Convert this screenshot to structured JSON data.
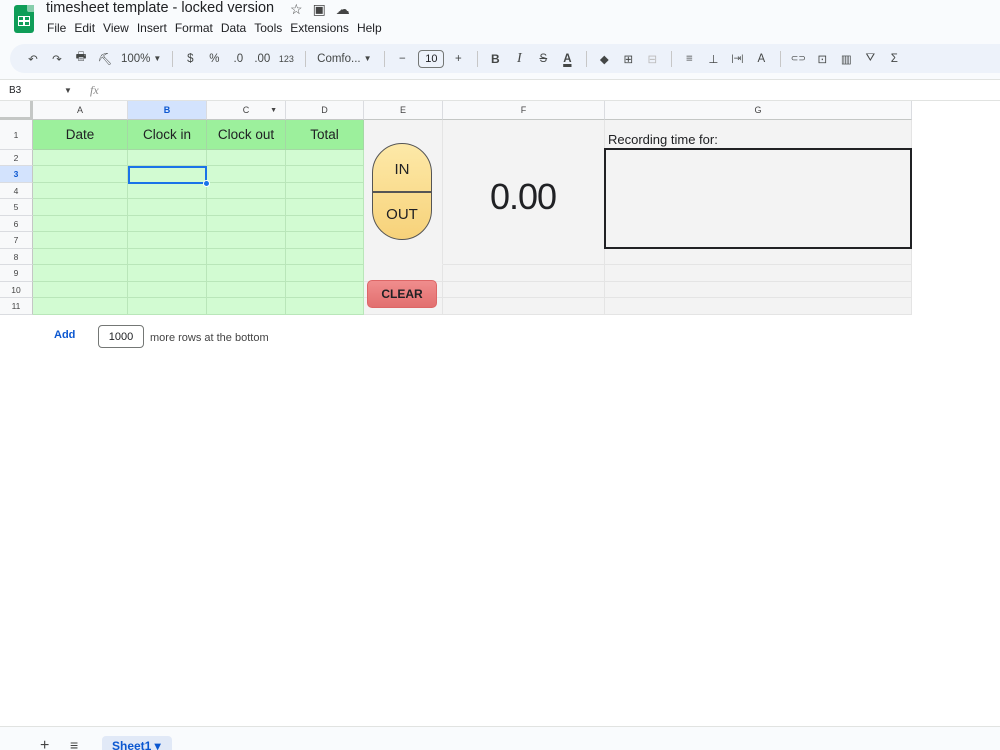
{
  "app": {
    "doc_title": "timesheet template - locked version",
    "menu": [
      "File",
      "Edit",
      "View",
      "Insert",
      "Format",
      "Data",
      "Tools",
      "Extensions",
      "Help"
    ],
    "brand_color": "#0f9d58"
  },
  "toolbar": {
    "undo": "↶",
    "redo": "↷",
    "print": "🖶",
    "paint_format": "⛏",
    "zoom": "100%",
    "currency": "$",
    "percent": "%",
    "decrease_decimal": ".0",
    "increase_decimal": ".00",
    "number_format": "123",
    "font": "Comfo...",
    "font_size_minus": "−",
    "font_size": "10",
    "font_size_plus": "+",
    "bold": "B",
    "italic": "I",
    "strikethrough": "S",
    "text_color": "A",
    "fill_color": "◆",
    "borders": "⊞",
    "merge": "⊟",
    "align": "≡",
    "valign": "⊥",
    "wrap": "|⇥|",
    "rotate": "A",
    "link": "⊂⊃",
    "comment": "⊡",
    "chart": "▥",
    "filter": "⛛",
    "functions": "Σ"
  },
  "formula_bar": {
    "name_box": "B3",
    "fx": "fx"
  },
  "grid": {
    "columns": [
      "A",
      "B",
      "C",
      "D",
      "E",
      "F",
      "G"
    ],
    "rows": [
      "1",
      "2",
      "3",
      "4",
      "5",
      "6",
      "7",
      "8",
      "9",
      "10",
      "11"
    ],
    "selected_column": "B",
    "selected_row": "3",
    "headers": [
      "Date",
      "Clock in",
      "Clock out",
      "Total"
    ]
  },
  "widgets": {
    "in_label": "IN",
    "out_label": "OUT",
    "clear_label": "CLEAR",
    "elapsed": "0.00",
    "recording_label": "Recording time for:",
    "recording_value": ""
  },
  "add_rows": {
    "add_label": "Add",
    "count": "1000",
    "suffix": "more rows at the bottom"
  },
  "bottom": {
    "add_sheet": "+",
    "all_sheets": "≡",
    "sheet_tab": "Sheet1 ▾"
  }
}
